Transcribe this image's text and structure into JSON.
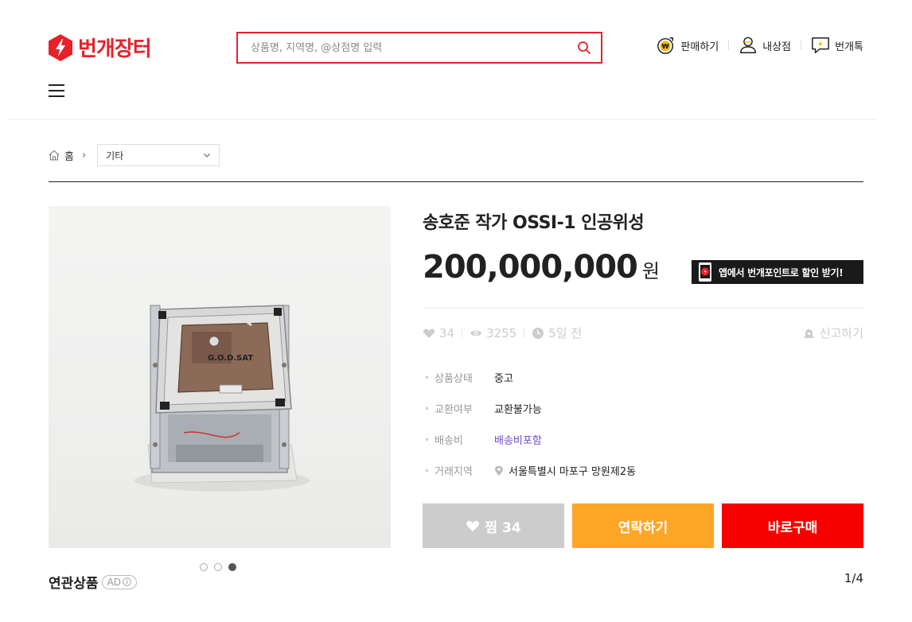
{
  "header": {
    "logo_text": "번개장터",
    "brand_color": "#e8202a",
    "search_placeholder": "상품명, 지역명, @상점명 입력",
    "menu": [
      {
        "label": "판매하기",
        "icon": "sell-won-icon"
      },
      {
        "label": "내상점",
        "icon": "user-icon"
      },
      {
        "label": "번개톡",
        "icon": "chat-icon"
      }
    ]
  },
  "breadcrumb": {
    "home": "홈",
    "category": "기타"
  },
  "product": {
    "title": "송호준 작가 OSSI-1 인공위성",
    "price": "200,000,000",
    "price_unit": "원",
    "app_banner": "앱에서 번개포인트로 할인 받기!",
    "stats": {
      "likes": "34",
      "views": "3255",
      "time": "5일 전"
    },
    "report_label": "신고하기",
    "details": [
      {
        "label": "상품상태",
        "value": "중고"
      },
      {
        "label": "교환여부",
        "value": "교환불가능"
      },
      {
        "label": "배송비",
        "value": "배송비포함"
      },
      {
        "label": "거래지역",
        "value": "서울특별시 마포구 망원제2동"
      }
    ],
    "image_dots": 3,
    "active_dot": 3
  },
  "actions": {
    "like_label": "찜 34",
    "contact_label": "연락하기",
    "buy_label": "바로구매",
    "colors": {
      "like": "#cccccc",
      "contact": "#fea628",
      "buy": "#f70000"
    }
  },
  "related": {
    "title": "연관상품",
    "ad_label": "AD",
    "page": "1/4"
  }
}
